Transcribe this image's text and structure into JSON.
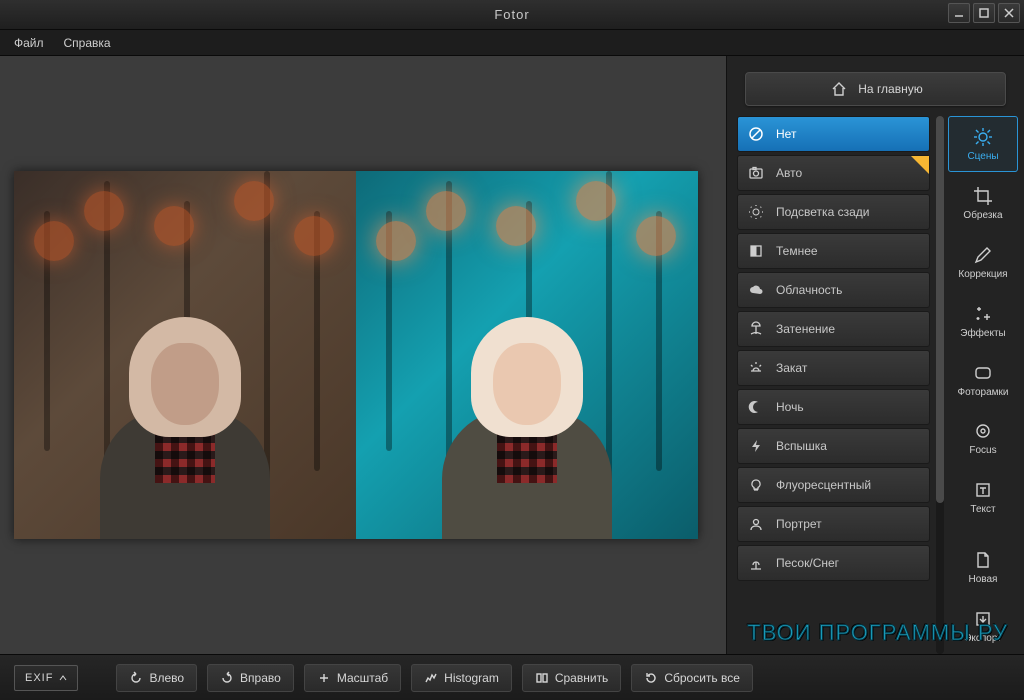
{
  "window": {
    "title": "Fotor"
  },
  "menu": {
    "file": "Файл",
    "help": "Справка"
  },
  "home": {
    "label": "На главную"
  },
  "scenes": [
    {
      "key": "none",
      "label": "Нет",
      "selected": true,
      "badge": false
    },
    {
      "key": "auto",
      "label": "Авто",
      "selected": false,
      "badge": true
    },
    {
      "key": "backlight",
      "label": "Подсветка сзади",
      "selected": false,
      "badge": false
    },
    {
      "key": "darker",
      "label": "Темнее",
      "selected": false,
      "badge": false
    },
    {
      "key": "cloudy",
      "label": "Облачность",
      "selected": false,
      "badge": false
    },
    {
      "key": "shade",
      "label": "Затенение",
      "selected": false,
      "badge": false
    },
    {
      "key": "sunset",
      "label": "Закат",
      "selected": false,
      "badge": false
    },
    {
      "key": "night",
      "label": "Ночь",
      "selected": false,
      "badge": false
    },
    {
      "key": "flash",
      "label": "Вспышка",
      "selected": false,
      "badge": false
    },
    {
      "key": "fluorescent",
      "label": "Флуоресцентный",
      "selected": false,
      "badge": false
    },
    {
      "key": "portrait",
      "label": "Портрет",
      "selected": false,
      "badge": false
    },
    {
      "key": "sandsnow",
      "label": "Песок/Снег",
      "selected": false,
      "badge": false
    }
  ],
  "tools": {
    "scenes": "Сцены",
    "crop": "Обрезка",
    "adjust": "Коррекция",
    "effects": "Эффекты",
    "frames": "Фоторамки",
    "focus": "Focus",
    "text": "Текст",
    "new": "Новая",
    "export": "Экспорт"
  },
  "bottom": {
    "exif": "EXIF",
    "left": "Влево",
    "right": "Вправо",
    "zoom": "Масштаб",
    "histogram": "Histogram",
    "compare": "Сравнить",
    "reset": "Сбросить все"
  },
  "watermark": "ТВОИ ПРОГРАММЫ РУ"
}
